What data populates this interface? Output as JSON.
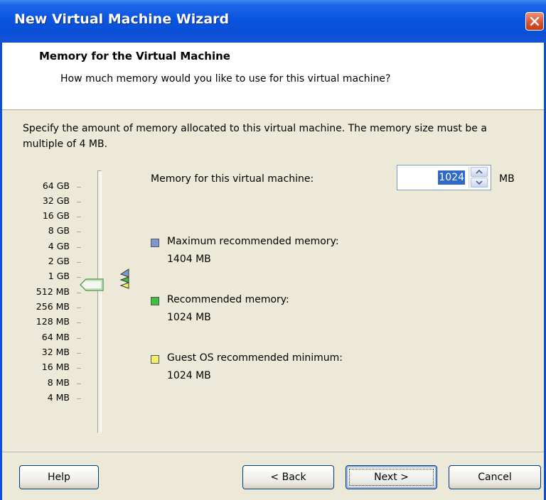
{
  "window": {
    "title": "New Virtual Machine Wizard"
  },
  "header": {
    "title": "Memory for the Virtual Machine",
    "subtitle": "How much memory would you like to use for this virtual machine?"
  },
  "main": {
    "description": "Specify the amount of memory allocated to this virtual machine. The memory size must be a multiple of 4 MB.",
    "memory_field": {
      "label": "Memory for this virtual machine:",
      "value": "1024",
      "unit": "MB"
    },
    "scale": {
      "labels": [
        "64 GB",
        "32 GB",
        "16 GB",
        "8 GB",
        "4 GB",
        "2 GB",
        "1 GB",
        "512 MB",
        "256 MB",
        "128 MB",
        "64 MB",
        "32 MB",
        "16 MB",
        "8 MB",
        "4 MB"
      ],
      "selected": "1 GB"
    },
    "legend": [
      {
        "label": "Maximum recommended memory:",
        "value": "1404 MB",
        "color": "#7C9AD0"
      },
      {
        "label": "Recommended memory:",
        "value": "1024 MB",
        "color": "#3CC23C"
      },
      {
        "label": "Guest OS recommended minimum:",
        "value": "1024 MB",
        "color": "#F5F06A"
      }
    ]
  },
  "footer": {
    "help": "Help",
    "back": "< Back",
    "next": "Next >",
    "cancel": "Cancel"
  },
  "colors": {
    "titlebar": "#0A4FD6",
    "dialog_bg": "#ECE9D8",
    "header_bg": "#FFFFFF",
    "selection": "#316AC5"
  },
  "icons": [
    "close-icon",
    "spin-up-icon",
    "spin-down-icon",
    "slider-thumb-icon",
    "memory-marker-icon"
  ]
}
